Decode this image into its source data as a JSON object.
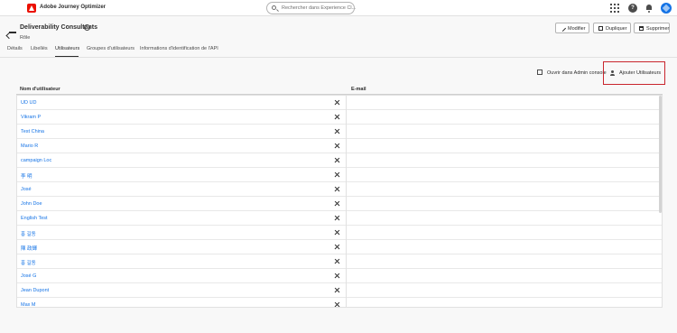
{
  "header": {
    "app_name": "Adobe Journey Optimizer",
    "search_placeholder": "Rechercher dans Experience Cl...",
    "help_label": "?"
  },
  "page": {
    "title": "Deliverability Consultants",
    "subtitle": "Rôle",
    "buttons": {
      "edit": "Modifier",
      "duplicate": "Dupliquer",
      "delete": "Supprimer"
    }
  },
  "tabs": [
    {
      "label": "Détails"
    },
    {
      "label": "Libellés"
    },
    {
      "label": "Utilisateurs"
    },
    {
      "label": "Groupes d'utilisateurs"
    },
    {
      "label": "Informations d'identification de l'API"
    }
  ],
  "actions": {
    "open_admin": "Ouvrir dans Admin console",
    "add_users": "Ajouter Utilisateurs"
  },
  "table": {
    "columns": [
      "Nom d'utilisateur",
      "E-mail"
    ],
    "rows": [
      {
        "name": "UD UD",
        "email": ""
      },
      {
        "name": "Vikram P",
        "email": ""
      },
      {
        "name": "Test China",
        "email": ""
      },
      {
        "name": "Mario R",
        "email": ""
      },
      {
        "name": "campaign Loc",
        "email": ""
      },
      {
        "name": "李 明",
        "email": ""
      },
      {
        "name": "José",
        "email": ""
      },
      {
        "name": "John Doe",
        "email": ""
      },
      {
        "name": "English Test",
        "email": ""
      },
      {
        "name": "홍 길동",
        "email": ""
      },
      {
        "name": "陳 政輝",
        "email": ""
      },
      {
        "name": "홍 길동",
        "email": ""
      },
      {
        "name": "José G",
        "email": ""
      },
      {
        "name": "Jean Dupont",
        "email": ""
      },
      {
        "name": "Max M",
        "email": ""
      }
    ]
  }
}
